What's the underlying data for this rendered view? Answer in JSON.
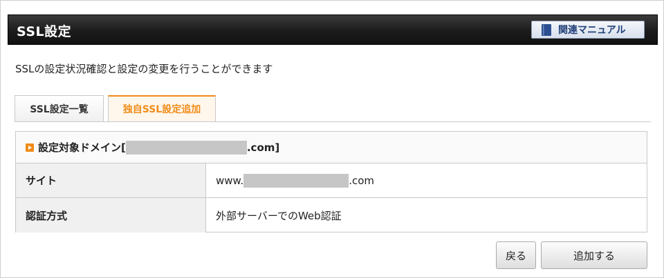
{
  "header": {
    "title": "SSL設定",
    "manual_label": "関連マニュアル",
    "manual_icon": "book-icon"
  },
  "description": "SSLの設定状況確認と設定の変更を行うことができます",
  "tabs": [
    {
      "label": "SSL設定一覧",
      "active": false
    },
    {
      "label": "独自SSL設定追加",
      "active": true
    }
  ],
  "panel": {
    "heading_prefix": "設定対象ドメイン[",
    "heading_suffix": ".com]",
    "rows": [
      {
        "label": "サイト",
        "value_prefix": "www.",
        "value_suffix": ".com"
      },
      {
        "label": "認証方式",
        "value": "外部サーバーでのWeb認証"
      }
    ]
  },
  "buttons": {
    "back": "戻る",
    "add": "追加する"
  },
  "colors": {
    "accent": "#f08c18",
    "header_bg": "#1c1c1c",
    "manual_text": "#1f3e78"
  }
}
